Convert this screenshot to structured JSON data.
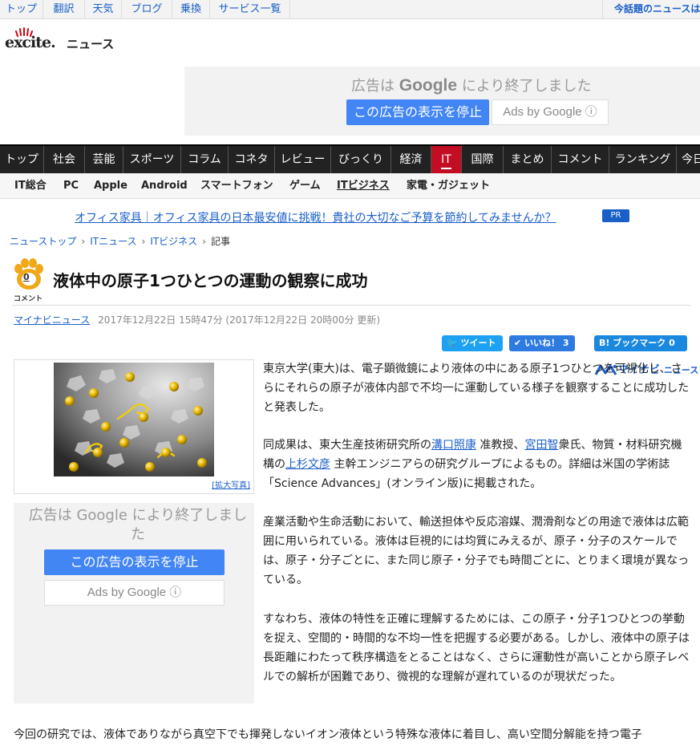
{
  "util": {
    "links": [
      "トップ",
      "翻訳",
      "天気",
      "ブログ",
      "乗換",
      "サービス一覧"
    ],
    "trending": "今話題のニュースは"
  },
  "header": {
    "logo_text": "excite.",
    "logo_news": "ニュース"
  },
  "top_ad": {
    "text_prefix": "広告は",
    "brand": "Google",
    "text_suffix": "により終了しました",
    "stop_label": "この広告の表示を停止",
    "ads_by": "Ads by Google ⓘ"
  },
  "nav": {
    "items": [
      "トップ",
      "社会",
      "芸能",
      "スポーツ",
      "コラム",
      "コネタ",
      "レビュー",
      "びっくり",
      "経済",
      "IT",
      "国際",
      "まとめ",
      "コメント",
      "ランキング",
      "今日"
    ],
    "active": "IT"
  },
  "subnav": {
    "items": [
      "IT総合",
      "PC",
      "Apple",
      "Android",
      "スマートフォン",
      "ゲーム",
      "ITビジネス",
      "家電・ガジェット"
    ]
  },
  "pr": {
    "text": "オフィス家具｜オフィス家具の日本最安値に挑戦！貴社の大切なご予算を節約してみませんか？",
    "badge": "PR"
  },
  "breadcrumb": [
    "ニューストップ",
    "ITニュース",
    "ITビジネス",
    "記事"
  ],
  "article": {
    "comment_count": "0",
    "comment_label": "コメント",
    "title": "液体中の原子1つひとつの運動の観察に成功",
    "source": "マイナビニュース",
    "date": "2017年12月22日 15時47分 (2017年12月22日 20時00分 更新)"
  },
  "social": {
    "tweet": "ツイート",
    "like": "いいね！",
    "like_count": "3",
    "hatena": "ブックマーク",
    "hatena_count": "0"
  },
  "mynavi": {
    "logo": "マイナビ",
    "news": "ニュース"
  },
  "figure": {
    "zoom": "[拡大写真]"
  },
  "side_ad": {
    "text": "広告は Google により終了しました",
    "stop_label": "この広告の表示を停止",
    "ads_by": "Ads by Google ⓘ"
  },
  "body": {
    "p1": "東京大学(東大)は、電子顕微鏡により液体の中にある原子1つひとつを可視化し、さらにそれらの原子が液体内部で不均一に運動している様子を観察することに成功したと発表した。",
    "p2_a": "同成果は、東大生産技術研究所の",
    "p2_link1": "溝口照康",
    "p2_b": " 准教授、",
    "p2_link2": "宮田智",
    "p2_c": "衆氏、物質・材料研究機構の",
    "p2_link3": "上杉文彦",
    "p2_d": " 主幹エンジニアらの研究グループによるもの。詳細は米国の学術誌「Science Advances」(オンライン版)に掲載された。",
    "p3": "産業活動や生命活動において、輸送担体や反応溶媒、潤滑剤などの用途で液体は広範囲に用いられている。液体は巨視的には均質にみえるが、原子・分子のスケールでは、原子・分子ごとに、また同じ原子・分子でも時間ごとに、とりまく環境が異なっている。",
    "p4": "すなわち、液体の特性を正確に理解するためには、この原子・分子1つひとつの挙動を捉え、空間的・時間的な不均一性を把握する必要がある。しかし、液体中の原子は長距離にわたって秩序構造をとることはなく、さらに運動性が高いことから原子レベルでの解析が困難であり、微視的な理解が遅れているのが現状だった。",
    "p5": "今回の研究では、液体でありながら真空下でも揮発しないイオン液体という特殊な液体に着目し、高い空間分解能を持つ電子"
  }
}
